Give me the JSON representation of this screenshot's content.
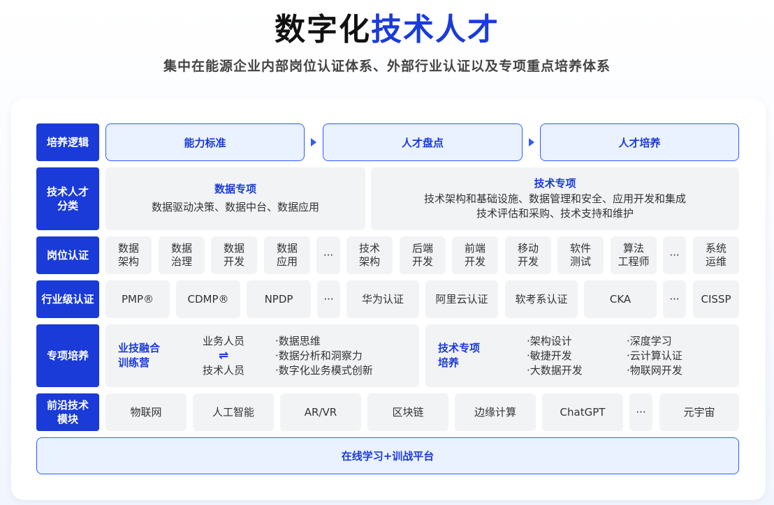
{
  "header": {
    "title_part1": "数字化",
    "title_part2": "技术人才",
    "subtitle": "集中在能源企业内部岗位认证体系、外部行业认证以及专项重点培养体系"
  },
  "rows": {
    "logic": {
      "label": "培养逻辑",
      "steps": [
        "能力标准",
        "人才盘点",
        "人才培养"
      ]
    },
    "category": {
      "label": "技术人才\n分类",
      "data": {
        "title": "数据专项",
        "desc": "数据驱动决策、数据中台、数据应用"
      },
      "tech": {
        "title": "技术专项",
        "desc1": "技术架构和基础设施、数据管理和安全、应用开发和集成",
        "desc2": "技术评估和采购、技术支持和维护"
      }
    },
    "position": {
      "label": "岗位认证",
      "items": [
        "数据\n架构",
        "数据\n治理",
        "数据\n开发",
        "数据\n应用",
        "···",
        "技术\n架构",
        "后端\n开发",
        "前端\n开发",
        "移动\n开发",
        "软件\n测试",
        "算法\n工程师",
        "···",
        "系统\n运维"
      ]
    },
    "industry": {
      "label": "行业级认证",
      "items": [
        "PMP®",
        "CDMP®",
        "NPDP",
        "···",
        "华为认证",
        "阿里云认证",
        "软考系认证",
        "CKA",
        "···",
        "CISSP"
      ]
    },
    "special": {
      "label": "专项培养",
      "camp": "业技融合\n训练营",
      "role_top": "业务人员",
      "role_arrow": "⇌",
      "role_bottom": "技术人员",
      "camp_points": [
        "·数据思维",
        "·数据分析和洞察力",
        "·数字化业务模式创新"
      ],
      "tech_train": "技术专项\n培养",
      "tech_col1": [
        "·架构设计",
        "·敏捷开发",
        "·大数据开发"
      ],
      "tech_col2": [
        "·深度学习",
        "·云计算认证",
        "·物联网开发"
      ]
    },
    "frontier": {
      "label": "前沿技术\n模块",
      "items": [
        "物联网",
        "人工智能",
        "AR/VR",
        "区块链",
        "边缘计算",
        "ChatGPT",
        "···",
        "元宇宙"
      ]
    }
  },
  "platform": "在线学习+训战平台",
  "colors": {
    "brand_blue": "#1a3bd8",
    "light_blue": "#eaf1ff",
    "gray_box": "#f2f3f5"
  }
}
